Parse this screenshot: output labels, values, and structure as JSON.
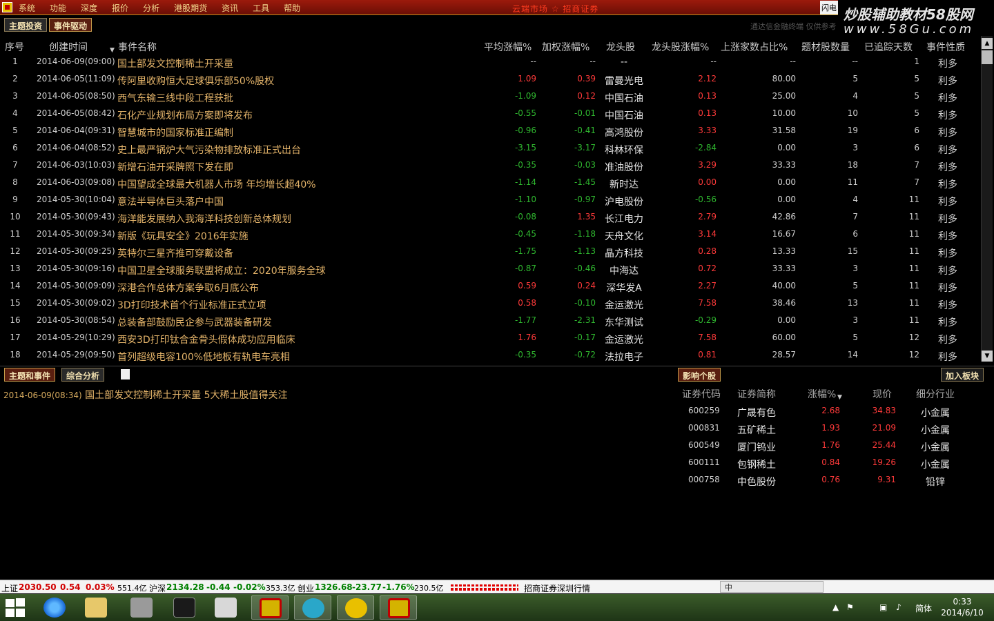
{
  "menubar": {
    "menus": [
      "系统",
      "功能",
      "深度",
      "报价",
      "分析",
      "港股期货",
      "资讯",
      "工具",
      "帮助"
    ],
    "alert": "云端市场 ☆ 招商证券",
    "box_label": "闪电"
  },
  "brand": {
    "line1": "炒股辅助教材58股网",
    "line2": "www.58Gu.com"
  },
  "tabs": {
    "theme": "主题投资",
    "event": "事件驱动",
    "hint": "通达信金融终端 仅供参考"
  },
  "table": {
    "headers": {
      "idx": "序号",
      "time": "创建时间",
      "name": "事件名称",
      "avg": "平均涨幅%",
      "weighted": "加权涨幅%",
      "leader": "龙头股",
      "leader_chg": "龙头股涨幅%",
      "up_ratio": "上涨家数占比%",
      "count": "题材股数量",
      "days": "已追踪天数",
      "nature": "事件性质"
    },
    "rows": [
      {
        "idx": "1",
        "time": "2014-06-09(09:00)",
        "name": "国土部发文控制稀土开采量",
        "avg": "--",
        "avg_c": "neutral",
        "wgt": "--",
        "wgt_c": "neutral",
        "lead": "--",
        "lchg": "--",
        "lchg_c": "neutral",
        "ratio": "--",
        "cnt": "--",
        "days": "1",
        "nat": "利多"
      },
      {
        "idx": "2",
        "time": "2014-06-05(11:09)",
        "name": "传阿里收购恒大足球俱乐部50%股权",
        "avg": "1.09",
        "avg_c": "red",
        "wgt": "0.39",
        "wgt_c": "red",
        "lead": "雷曼光电",
        "lchg": "2.12",
        "lchg_c": "red",
        "ratio": "80.00",
        "cnt": "5",
        "days": "5",
        "nat": "利多"
      },
      {
        "idx": "3",
        "time": "2014-06-05(08:50)",
        "name": "西气东输三线中段工程获批",
        "avg": "-1.09",
        "avg_c": "green",
        "wgt": "0.12",
        "wgt_c": "red",
        "lead": "中国石油",
        "lchg": "0.13",
        "lchg_c": "red",
        "ratio": "25.00",
        "cnt": "4",
        "days": "5",
        "nat": "利多"
      },
      {
        "idx": "4",
        "time": "2014-06-05(08:42)",
        "name": "石化产业规划布局方案即将发布",
        "avg": "-0.55",
        "avg_c": "green",
        "wgt": "-0.01",
        "wgt_c": "green",
        "lead": "中国石油",
        "lchg": "0.13",
        "lchg_c": "red",
        "ratio": "10.00",
        "cnt": "10",
        "days": "5",
        "nat": "利多"
      },
      {
        "idx": "5",
        "time": "2014-06-04(09:31)",
        "name": "智慧城市的国家标准正编制",
        "avg": "-0.96",
        "avg_c": "green",
        "wgt": "-0.41",
        "wgt_c": "green",
        "lead": "高鸿股份",
        "lchg": "3.33",
        "lchg_c": "red",
        "ratio": "31.58",
        "cnt": "19",
        "days": "6",
        "nat": "利多"
      },
      {
        "idx": "6",
        "time": "2014-06-04(08:52)",
        "name": "史上最严锅炉大气污染物排放标准正式出台",
        "avg": "-3.15",
        "avg_c": "green",
        "wgt": "-3.17",
        "wgt_c": "green",
        "lead": "科林环保",
        "lchg": "-2.84",
        "lchg_c": "green",
        "ratio": "0.00",
        "cnt": "3",
        "days": "6",
        "nat": "利多"
      },
      {
        "idx": "7",
        "time": "2014-06-03(10:03)",
        "name": "新增石油开采牌照下发在即",
        "avg": "-0.35",
        "avg_c": "green",
        "wgt": "-0.03",
        "wgt_c": "green",
        "lead": "准油股份",
        "lchg": "3.29",
        "lchg_c": "red",
        "ratio": "33.33",
        "cnt": "18",
        "days": "7",
        "nat": "利多"
      },
      {
        "idx": "8",
        "time": "2014-06-03(09:08)",
        "name": "中国望成全球最大机器人市场 年均增长超40%",
        "avg": "-1.14",
        "avg_c": "green",
        "wgt": "-1.45",
        "wgt_c": "green",
        "lead": "新时达",
        "lchg": "0.00",
        "lchg_c": "red",
        "ratio": "0.00",
        "cnt": "11",
        "days": "7",
        "nat": "利多"
      },
      {
        "idx": "9",
        "time": "2014-05-30(10:04)",
        "name": "意法半导体巨头落户中国",
        "avg": "-1.10",
        "avg_c": "green",
        "wgt": "-0.97",
        "wgt_c": "green",
        "lead": "沪电股份",
        "lchg": "-0.56",
        "lchg_c": "green",
        "ratio": "0.00",
        "cnt": "4",
        "days": "11",
        "nat": "利多"
      },
      {
        "idx": "10",
        "time": "2014-05-30(09:43)",
        "name": "海洋能发展纳入我海洋科技创新总体规划",
        "avg": "-0.08",
        "avg_c": "green",
        "wgt": "1.35",
        "wgt_c": "red",
        "lead": "长江电力",
        "lchg": "2.79",
        "lchg_c": "red",
        "ratio": "42.86",
        "cnt": "7",
        "days": "11",
        "nat": "利多"
      },
      {
        "idx": "11",
        "time": "2014-05-30(09:34)",
        "name": "新版《玩具安全》2016年实施",
        "avg": "-0.45",
        "avg_c": "green",
        "wgt": "-1.18",
        "wgt_c": "green",
        "lead": "天舟文化",
        "lchg": "3.14",
        "lchg_c": "red",
        "ratio": "16.67",
        "cnt": "6",
        "days": "11",
        "nat": "利多"
      },
      {
        "idx": "12",
        "time": "2014-05-30(09:25)",
        "name": "英特尔三星齐推可穿戴设备",
        "avg": "-1.75",
        "avg_c": "green",
        "wgt": "-1.13",
        "wgt_c": "green",
        "lead": "晶方科技",
        "lchg": "0.28",
        "lchg_c": "red",
        "ratio": "13.33",
        "cnt": "15",
        "days": "11",
        "nat": "利多"
      },
      {
        "idx": "13",
        "time": "2014-05-30(09:16)",
        "name": "中国卫星全球服务联盟将成立：2020年服务全球",
        "avg": "-0.87",
        "avg_c": "green",
        "wgt": "-0.46",
        "wgt_c": "green",
        "lead": "中海达",
        "lchg": "0.72",
        "lchg_c": "red",
        "ratio": "33.33",
        "cnt": "3",
        "days": "11",
        "nat": "利多"
      },
      {
        "idx": "14",
        "time": "2014-05-30(09:09)",
        "name": "深港合作总体方案争取6月底公布",
        "avg": "0.59",
        "avg_c": "red",
        "wgt": "0.24",
        "wgt_c": "red",
        "lead": "深华发A",
        "lchg": "2.27",
        "lchg_c": "red",
        "ratio": "40.00",
        "cnt": "5",
        "days": "11",
        "nat": "利多"
      },
      {
        "idx": "15",
        "time": "2014-05-30(09:02)",
        "name": "3D打印技术首个行业标准正式立项",
        "avg": "0.58",
        "avg_c": "red",
        "wgt": "-0.10",
        "wgt_c": "green",
        "lead": "金运激光",
        "lchg": "7.58",
        "lchg_c": "red",
        "ratio": "38.46",
        "cnt": "13",
        "days": "11",
        "nat": "利多"
      },
      {
        "idx": "16",
        "time": "2014-05-30(08:54)",
        "name": "总装备部鼓励民企参与武器装备研发",
        "avg": "-1.77",
        "avg_c": "green",
        "wgt": "-2.31",
        "wgt_c": "green",
        "lead": "东华测试",
        "lchg": "-0.29",
        "lchg_c": "green",
        "ratio": "0.00",
        "cnt": "3",
        "days": "11",
        "nat": "利多"
      },
      {
        "idx": "17",
        "time": "2014-05-29(10:29)",
        "name": "西安3D打印钛合金骨头假体成功应用临床",
        "avg": "1.76",
        "avg_c": "red",
        "wgt": "-0.17",
        "wgt_c": "green",
        "lead": "金运激光",
        "lchg": "7.58",
        "lchg_c": "red",
        "ratio": "60.00",
        "cnt": "5",
        "days": "12",
        "nat": "利多"
      },
      {
        "idx": "18",
        "time": "2014-05-29(09:50)",
        "name": "首列超级电容100%低地板有轨电车亮相",
        "avg": "-0.35",
        "avg_c": "green",
        "wgt": "-0.72",
        "wgt_c": "green",
        "lead": "法拉电子",
        "lchg": "0.81",
        "lchg_c": "red",
        "ratio": "28.57",
        "cnt": "14",
        "days": "12",
        "nat": "利多"
      }
    ]
  },
  "lower": {
    "tab_theme_event": "主题和事件",
    "tab_analysis": "综合分析",
    "tab_impact": "影响个股",
    "add_button": "加入板块",
    "news_time": "2014-06-09(08:34)",
    "news_title": "国土部发文控制稀土开采量 5大稀土股值得关注",
    "stock_headers": {
      "code": "证券代码",
      "name": "证券简称",
      "chg": "涨幅%",
      "price": "现价",
      "industry": "细分行业"
    },
    "stocks": [
      {
        "code": "600259",
        "name": "广晟有色",
        "chg": "2.68",
        "price": "34.83",
        "industry": "小金属"
      },
      {
        "code": "000831",
        "name": "五矿稀土",
        "chg": "1.93",
        "price": "21.09",
        "industry": "小金属"
      },
      {
        "code": "600549",
        "name": "厦门钨业",
        "chg": "1.76",
        "price": "25.44",
        "industry": "小金属"
      },
      {
        "code": "600111",
        "name": "包钢稀土",
        "chg": "0.84",
        "price": "19.26",
        "industry": "小金属"
      },
      {
        "code": "000758",
        "name": "中色股份",
        "chg": "0.76",
        "price": "9.31",
        "industry": "铅锌"
      }
    ]
  },
  "statusbar": {
    "sh_label": "上证",
    "sh_value": "2030.50",
    "sh_chg": "0.54",
    "sh_pct": "0.03%",
    "sh_amt": "551.4亿",
    "sz_label": "沪深",
    "sz_value": "2134.28",
    "sz_chg": "-0.44",
    "sz_pct": "-0.02%",
    "sz_amt": "353.3亿",
    "cy_label": "创业",
    "cy_value": "1326.68",
    "cy_chg": "-23.77",
    "cy_pct": "-1.76%",
    "cy_amt": "230.5亿",
    "broker": "招商证券深圳行情",
    "ime": "中"
  },
  "taskbar": {
    "lang": "简体",
    "time": "0:33",
    "date": "2014/6/10"
  }
}
